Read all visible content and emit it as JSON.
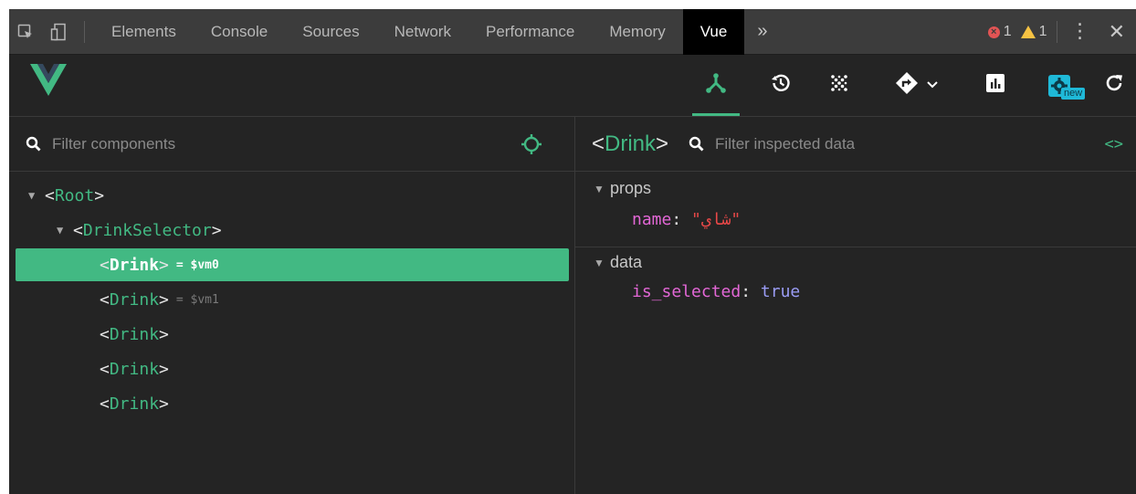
{
  "devtools": {
    "tabs": [
      "Elements",
      "Console",
      "Sources",
      "Network",
      "Performance",
      "Memory",
      "Vue"
    ],
    "active_tab": "Vue",
    "more": "»",
    "errors": "1",
    "warnings": "1"
  },
  "vue_toolbar": {
    "new_badge": "new",
    "tools": [
      "components-icon",
      "history-icon",
      "vuex-dots-icon",
      "router-icon",
      "chevron-down-icon",
      "performance-chart-icon",
      "settings-icon",
      "refresh-icon"
    ]
  },
  "components": {
    "filter_placeholder": "Filter components",
    "tree": [
      {
        "name": "Root",
        "arrow": "▼",
        "indent": 0
      },
      {
        "name": "DrinkSelector",
        "arrow": "▼",
        "indent": 1
      },
      {
        "name": "Drink",
        "vm": "= $vm0",
        "selected": true,
        "indent": 2
      },
      {
        "name": "Drink",
        "vm": "= $vm1",
        "indent": 2
      },
      {
        "name": "Drink",
        "indent": 2
      },
      {
        "name": "Drink",
        "indent": 2
      },
      {
        "name": "Drink",
        "indent": 2
      }
    ]
  },
  "inspector": {
    "component": "Drink",
    "filter_placeholder": "Filter inspected data",
    "code_icon": "<>",
    "sections": [
      {
        "title": "props",
        "arrow": "▼",
        "key": "name",
        "value": "\"شاي\"",
        "type": "string"
      },
      {
        "title": "data",
        "arrow": "▼",
        "key": "is_selected",
        "value": "true",
        "type": "boolean"
      }
    ]
  },
  "colors": {
    "accent": "#42b983",
    "background": "#242424",
    "tabbar": "#3c3c3c"
  }
}
